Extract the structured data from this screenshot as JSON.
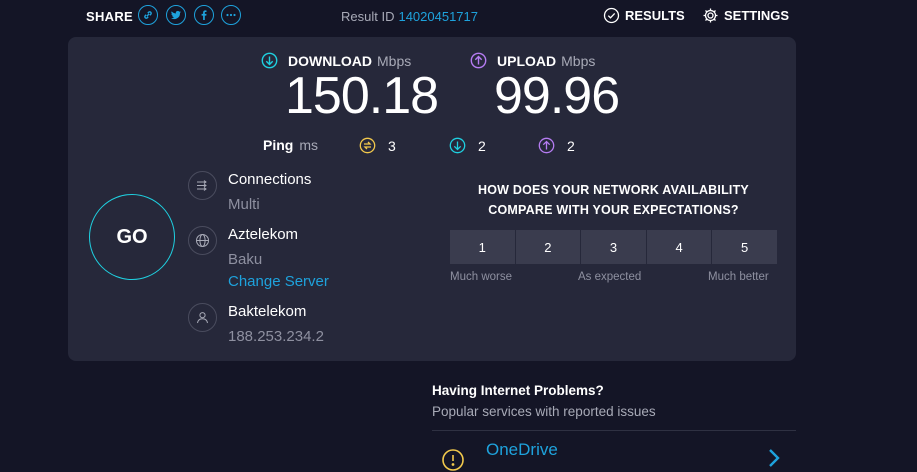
{
  "header": {
    "share_label": "SHARE",
    "share_buttons": [
      "link-icon",
      "twitter-icon",
      "facebook-icon",
      "more-icon"
    ],
    "result_label": "Result ID",
    "result_id": "14020451717",
    "results_label": "RESULTS",
    "settings_label": "SETTINGS"
  },
  "speed": {
    "download": {
      "label": "DOWNLOAD",
      "unit": "Mbps",
      "value": "150.18",
      "icon": "download-arrow-icon"
    },
    "upload": {
      "label": "UPLOAD",
      "unit": "Mbps",
      "value": "99.96",
      "icon": "upload-arrow-icon"
    }
  },
  "ping": {
    "label": "Ping",
    "unit": "ms",
    "idle": "3",
    "download": "2",
    "upload": "2"
  },
  "go_label": "GO",
  "connections": {
    "title": "Connections",
    "value": "Multi"
  },
  "server": {
    "name": "Aztelekom",
    "location": "Baku",
    "change_label": "Change Server"
  },
  "provider": {
    "name": "Baktelekom",
    "ip": "188.253.234.2"
  },
  "survey": {
    "question": "HOW DOES YOUR NETWORK AVAILABILITY COMPARE WITH YOUR EXPECTATIONS?",
    "options": [
      "1",
      "2",
      "3",
      "4",
      "5"
    ],
    "low_label": "Much worse",
    "mid_label": "As expected",
    "high_label": "Much better"
  },
  "problems": {
    "title": "Having Internet Problems?",
    "subtitle": "Popular services with reported issues",
    "services": [
      {
        "name": "OneDrive"
      }
    ]
  },
  "colors": {
    "background": "#141526",
    "card": "#26283a",
    "accent_blue": "#1ea2dc",
    "download": "#1fd0e0",
    "upload": "#b57cf2",
    "ping_idle": "#f2c94c"
  }
}
